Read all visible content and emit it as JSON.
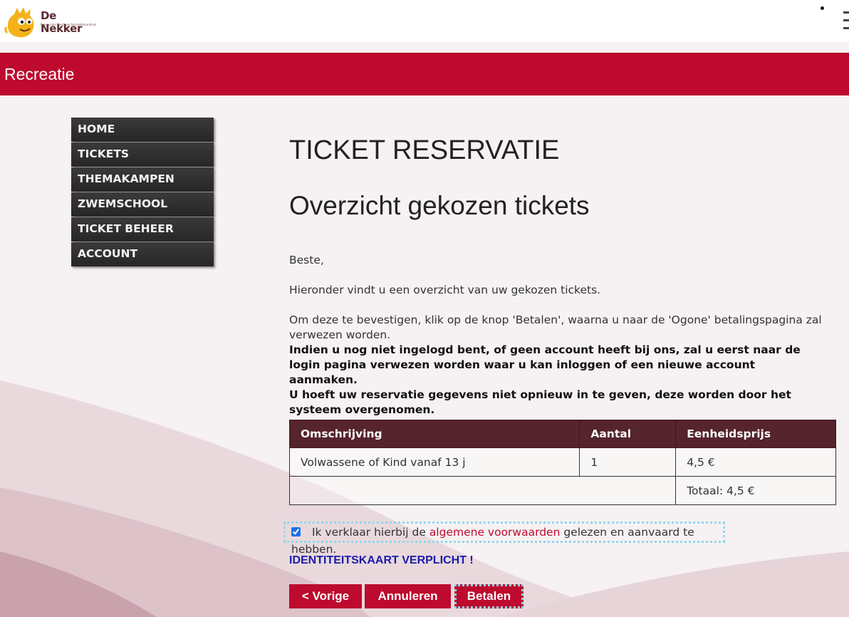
{
  "header": {
    "logo_title": "De Nekker",
    "logo_subtitle": "Provinciaal Sport- en Recreatiecentrum"
  },
  "band": {
    "title": "Recreatie"
  },
  "nav": {
    "items": [
      {
        "label": "HOME"
      },
      {
        "label": "TICKETS"
      },
      {
        "label": "THEMAKAMPEN"
      },
      {
        "label": "ZWEMSCHOOL"
      },
      {
        "label": "TICKET BEHEER"
      },
      {
        "label": "ACCOUNT"
      }
    ]
  },
  "main": {
    "title": "TICKET RESERVATIE",
    "subtitle": "Overzicht gekozen tickets",
    "greeting": "Beste,",
    "intro": "Hieronder vindt u een overzicht van uw gekozen tickets.",
    "confirm_text": "Om deze te bevestigen, klik op de knop 'Betalen', waarna u naar de 'Ogone' betalingspagina zal verwezen worden.",
    "login_note": "Indien u nog niet ingelogd bent, of geen account heeft bij ons, zal u eerst naar de login pagina verwezen worden waar u kan inloggen of een nieuwe account aanmaken.",
    "data_note": "U hoeft uw reservatie gegevens niet opnieuw in te geven, deze worden door het systeem overgenomen."
  },
  "table": {
    "headers": [
      "Omschrijving",
      "Aantal",
      "Eenheidsprijs"
    ],
    "rows": [
      [
        "Volwassene of Kind vanaf 13 j",
        "1",
        "4,5 €"
      ]
    ],
    "total": "Totaal: 4,5 €"
  },
  "terms": {
    "checked": true,
    "prefix": "Ik verklaar hierbij de",
    "link": "algemene voorwaarden",
    "suffix": "gelezen en aanvaard te hebben."
  },
  "id_note": "IDENTITEITSKAART VERPLICHT !",
  "buttons": {
    "prev": "< Vorige",
    "cancel": "Annuleren",
    "pay": "Betalen"
  },
  "colors": {
    "brand_red": "#bd0a2e",
    "table_header": "#55242c",
    "nav_bg": "#2b2b2b"
  }
}
